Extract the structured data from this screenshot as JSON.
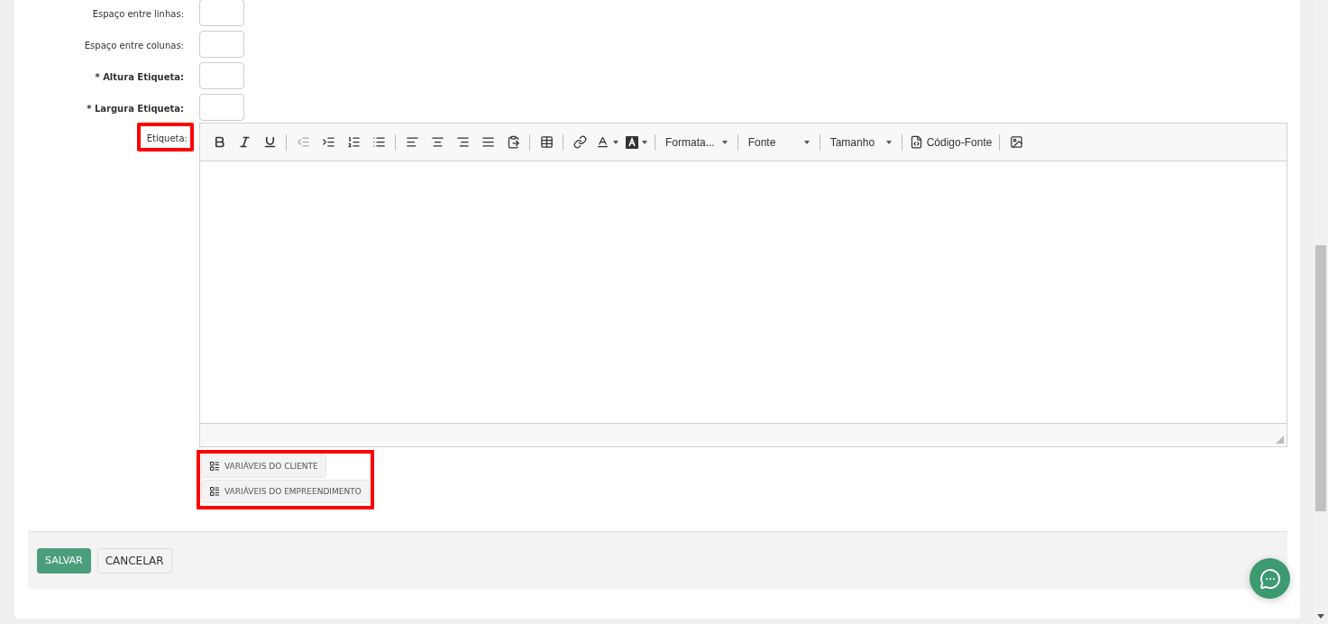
{
  "fields": [
    {
      "label": "Espaço entre linhas:",
      "required": false,
      "highlighted": false
    },
    {
      "label": "Espaço entre colunas:",
      "required": false,
      "highlighted": false
    },
    {
      "label": "* Altura Etiqueta:",
      "required": true,
      "highlighted": false
    },
    {
      "label": "* Largura Etiqueta:",
      "required": true,
      "highlighted": false
    }
  ],
  "editor": {
    "label": "Etiqueta:",
    "highlighted": true,
    "toolbar": [
      {
        "kind": "bold",
        "disabled": false
      },
      {
        "kind": "italic",
        "disabled": false
      },
      {
        "kind": "underline",
        "disabled": false
      },
      {
        "kind": "separator"
      },
      {
        "kind": "outdent",
        "disabled": true
      },
      {
        "kind": "indent",
        "disabled": false
      },
      {
        "kind": "numbered",
        "disabled": false
      },
      {
        "kind": "bullets",
        "disabled": false
      },
      {
        "kind": "separator"
      },
      {
        "kind": "alignleft",
        "disabled": false
      },
      {
        "kind": "center",
        "disabled": false
      },
      {
        "kind": "alignright",
        "disabled": false
      },
      {
        "kind": "justify",
        "disabled": false
      },
      {
        "kind": "paste",
        "disabled": false
      },
      {
        "kind": "separator"
      },
      {
        "kind": "table",
        "disabled": false
      },
      {
        "kind": "separator"
      },
      {
        "kind": "link",
        "disabled": false
      },
      {
        "kind": "textcolor"
      },
      {
        "kind": "bgcolor"
      },
      {
        "kind": "separator"
      },
      {
        "kind": "dropdown",
        "label": "Formata..."
      },
      {
        "kind": "separator"
      },
      {
        "kind": "dropdown",
        "label": "Fonte"
      },
      {
        "kind": "separator"
      },
      {
        "kind": "dropdown",
        "label": "Tamanho"
      },
      {
        "kind": "separator"
      },
      {
        "kind": "source",
        "label": "Código-Fonte"
      },
      {
        "kind": "separator"
      },
      {
        "kind": "image",
        "disabled": false
      }
    ]
  },
  "variables": {
    "highlighted": true,
    "buttons": [
      "VARIÁVEIS DO CLIENTE",
      "VARIÁVEIS DO EMPREENDIMENTO"
    ]
  },
  "actions": [
    {
      "label": "SALVAR",
      "kind": "primary"
    },
    {
      "label": "CANCELAR",
      "kind": "default"
    }
  ]
}
